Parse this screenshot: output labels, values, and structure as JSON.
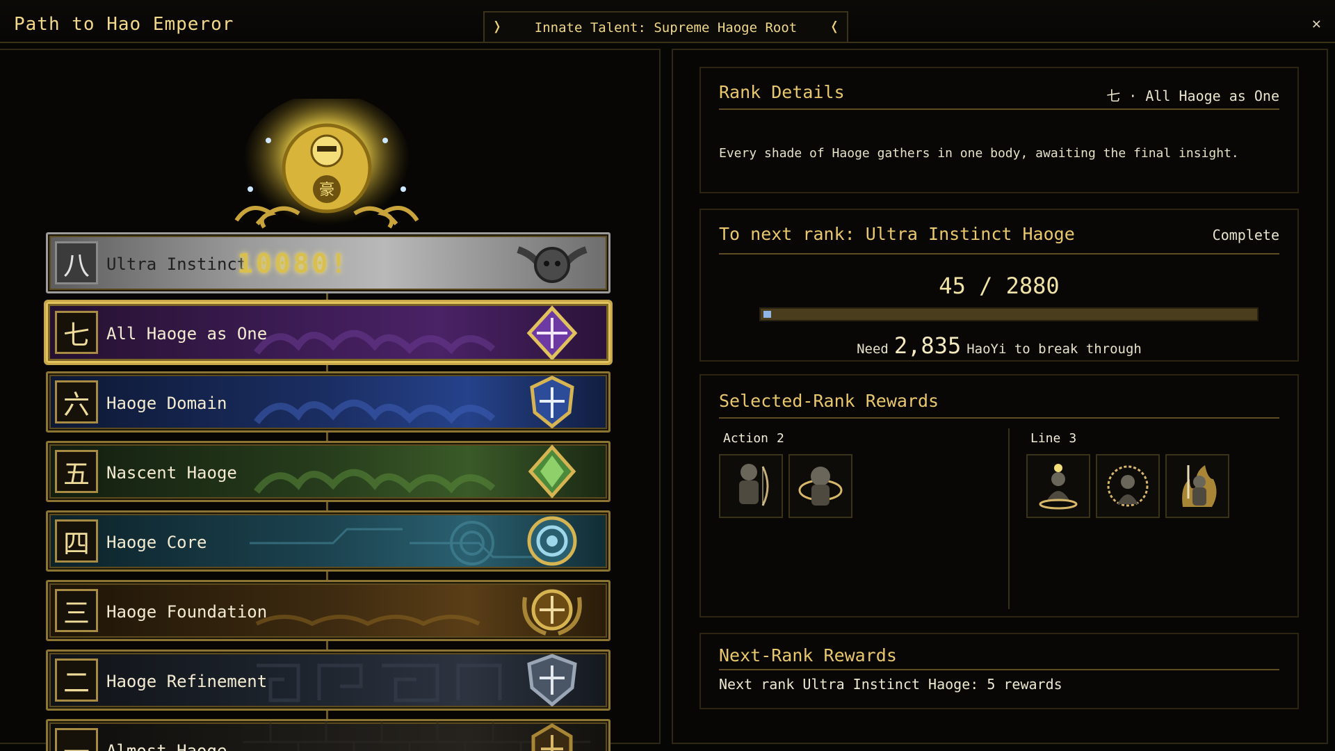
{
  "header": {
    "title": "Path to Hao Emperor",
    "talent": "Innate Talent: Supreme Haoge Root",
    "prev_arrow": "❭",
    "next_arrow": "❬",
    "close": "✕"
  },
  "ranks": [
    {
      "numeral": "八",
      "name": "Ultra Instinct",
      "score": "10080!",
      "theme": "silver"
    },
    {
      "numeral": "七",
      "name": "All Haoge as One",
      "theme": "purple",
      "selected": true
    },
    {
      "numeral": "六",
      "name": "Haoge Domain",
      "theme": "blue"
    },
    {
      "numeral": "五",
      "name": "Nascent Haoge",
      "theme": "green"
    },
    {
      "numeral": "四",
      "name": "Haoge Core",
      "theme": "teal"
    },
    {
      "numeral": "三",
      "name": "Haoge Foundation",
      "theme": "bronze"
    },
    {
      "numeral": "二",
      "name": "Haoge Refinement",
      "theme": "steel"
    },
    {
      "numeral": "一",
      "name": "Almost Haoge",
      "theme": "stone"
    }
  ],
  "details": {
    "title": "Rank Details",
    "crumb": "七 · All Haoge as One",
    "description": "Every shade of Haoge gathers in one body, awaiting the final insight."
  },
  "next_rank": {
    "title": "To next rank: Ultra Instinct Haoge",
    "status": "Complete",
    "progress_text": "45 / 2880",
    "current": 45,
    "target": 2880,
    "need_prefix": "Need",
    "need_amount": "2,835",
    "need_suffix": "HaoYi to break through"
  },
  "selected_rewards": {
    "title": "Selected-Rank Rewards",
    "action_label": "Action",
    "action_count": "2",
    "line_label": "Line",
    "line_count": "3"
  },
  "next_rewards": {
    "title": "Next-Rank Rewards",
    "summary": "Next rank Ultra Instinct Haoge: 5 rewards"
  },
  "colors": {
    "gold": "#e9c76c",
    "frame": "#8c7433",
    "progress_fill": "#8fb6e6"
  }
}
